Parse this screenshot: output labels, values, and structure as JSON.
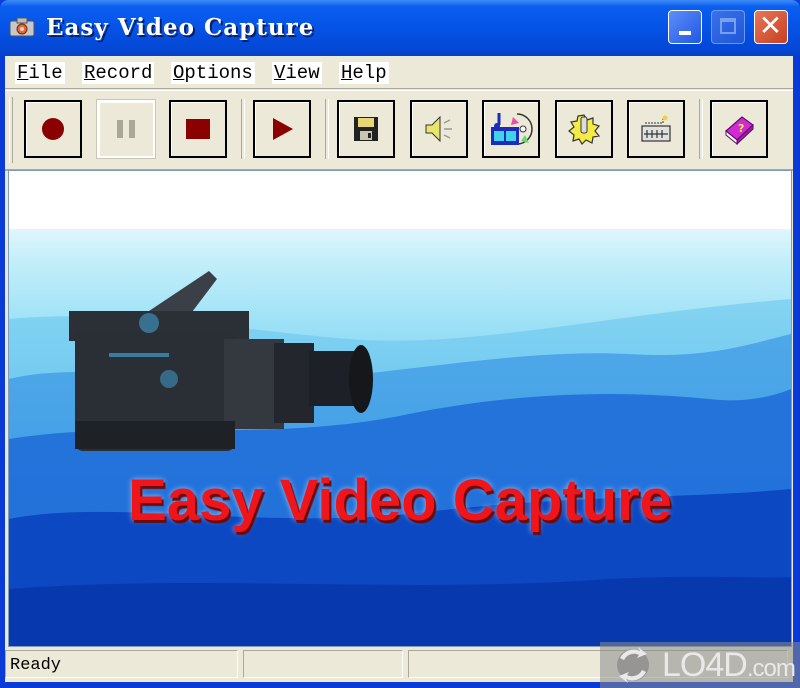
{
  "window": {
    "title": "Easy Video Capture",
    "controls": {
      "minimize_icon": "minimize-icon",
      "maximize_icon": "maximize-icon",
      "close_icon": "close-icon",
      "close_glyph": "✕"
    }
  },
  "menu": {
    "items": [
      {
        "accel": "F",
        "rest": "ile"
      },
      {
        "accel": "R",
        "rest": "ecord"
      },
      {
        "accel": "O",
        "rest": "ptions"
      },
      {
        "accel": "V",
        "rest": "iew"
      },
      {
        "accel": "H",
        "rest": "elp"
      }
    ]
  },
  "toolbar": {
    "buttons": [
      {
        "name": "record",
        "icon": "record-icon",
        "enabled": true
      },
      {
        "name": "pause",
        "icon": "pause-icon",
        "enabled": false
      },
      {
        "name": "stop",
        "icon": "stop-icon",
        "enabled": true
      },
      {
        "name": "play",
        "icon": "play-icon",
        "enabled": true
      },
      {
        "name": "save",
        "icon": "floppy-disk-icon",
        "enabled": true
      },
      {
        "name": "audio",
        "icon": "speaker-icon",
        "enabled": true
      },
      {
        "name": "video-settings",
        "icon": "film-cd-icon",
        "enabled": true
      },
      {
        "name": "settings",
        "icon": "gear-icon",
        "enabled": true
      },
      {
        "name": "hotkeys",
        "icon": "keyboard-icon",
        "enabled": true
      },
      {
        "name": "help",
        "icon": "help-book-icon",
        "enabled": true
      }
    ]
  },
  "content": {
    "banner_title": "Easy Video Capture",
    "banner_image": "camcorder-icon"
  },
  "status": {
    "panes": [
      "Ready",
      "",
      ""
    ]
  },
  "watermark": {
    "brand": "LO4D",
    "suffix": ".com"
  },
  "colors": {
    "titlebar_blue": "#0553e6",
    "record_red": "#8b0000",
    "banner_text_red": "#f0141b",
    "face": "#ece9d8"
  }
}
